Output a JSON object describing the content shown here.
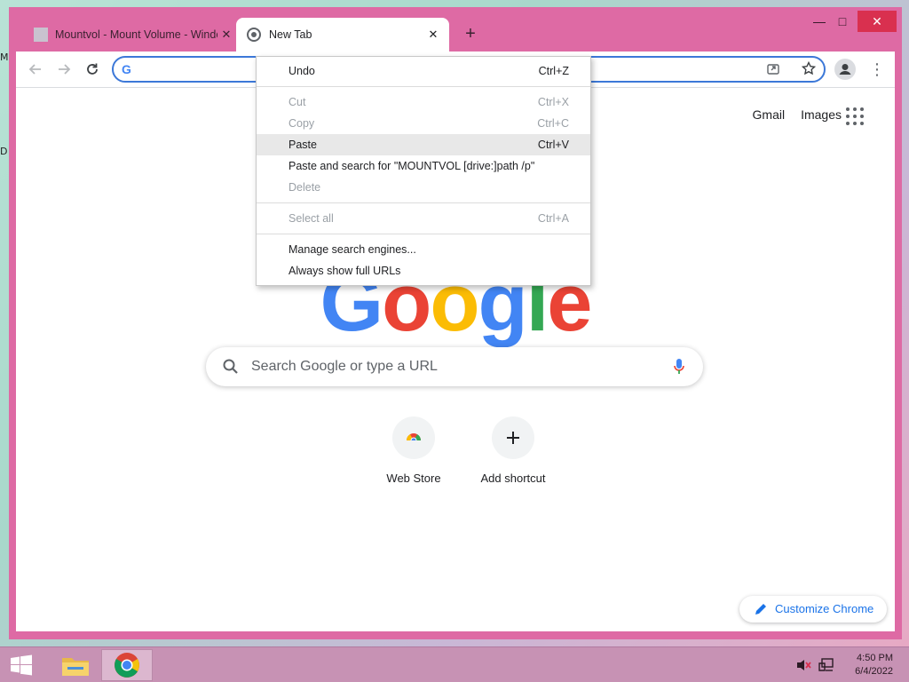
{
  "browser": {
    "tabs": [
      {
        "title": "Mountvol - Mount Volume - Windows CMD",
        "active": false
      },
      {
        "title": "New Tab",
        "active": true
      }
    ],
    "tab_close_glyph": "✕",
    "new_tab_glyph": "+"
  },
  "window_controls": {
    "minimize": "—",
    "maximize": "□",
    "close": "✕"
  },
  "toolbar": {
    "back_icon": "arrow-left-icon",
    "forward_icon": "arrow-right-icon",
    "reload_icon": "reload-icon",
    "omnibox_value": "",
    "omnibox_badge": "G"
  },
  "ntp": {
    "links": [
      "Gmail",
      "Images"
    ],
    "logo_letters": [
      {
        "char": "G",
        "color": "#4285f4"
      },
      {
        "char": "o",
        "color": "#ea4335"
      },
      {
        "char": "o",
        "color": "#fbbc05"
      },
      {
        "char": "g",
        "color": "#4285f4"
      },
      {
        "char": "l",
        "color": "#34a853"
      },
      {
        "char": "e",
        "color": "#ea4335"
      }
    ],
    "search_placeholder": "Search Google or type a URL",
    "shortcuts": [
      {
        "label": "Web Store",
        "icon": "chrome-web-store-icon"
      },
      {
        "label": "Add shortcut",
        "icon": "plus-icon"
      }
    ],
    "customize_label": "Customize Chrome"
  },
  "context_menu": {
    "items": [
      {
        "label": "Undo",
        "shortcut": "Ctrl+Z",
        "enabled": true
      },
      {
        "label": "Cut",
        "shortcut": "Ctrl+X",
        "enabled": false
      },
      {
        "label": "Copy",
        "shortcut": "Ctrl+C",
        "enabled": false
      },
      {
        "label": "Paste",
        "shortcut": "Ctrl+V",
        "enabled": true,
        "highlighted": true
      },
      {
        "label": "Paste and search for \"MOUNTVOL [drive:]path /p\"",
        "shortcut": "",
        "enabled": true
      },
      {
        "label": "Delete",
        "shortcut": "",
        "enabled": false
      },
      {
        "label": "Select all",
        "shortcut": "Ctrl+A",
        "enabled": false
      },
      {
        "label": "Manage search engines...",
        "shortcut": "",
        "enabled": true
      },
      {
        "label": "Always show full URLs",
        "shortcut": "",
        "enabled": true
      }
    ]
  },
  "desktop": {
    "stub_labels": [
      "M",
      "D"
    ]
  },
  "taskbar": {
    "clock_time": "4:50 PM",
    "clock_date": "6/4/2022"
  },
  "colors": {
    "window_frame": "#de6aa4",
    "accent": "#1a73e8",
    "omnibox_border": "#3c78d8",
    "taskbar": "#c792b4"
  }
}
